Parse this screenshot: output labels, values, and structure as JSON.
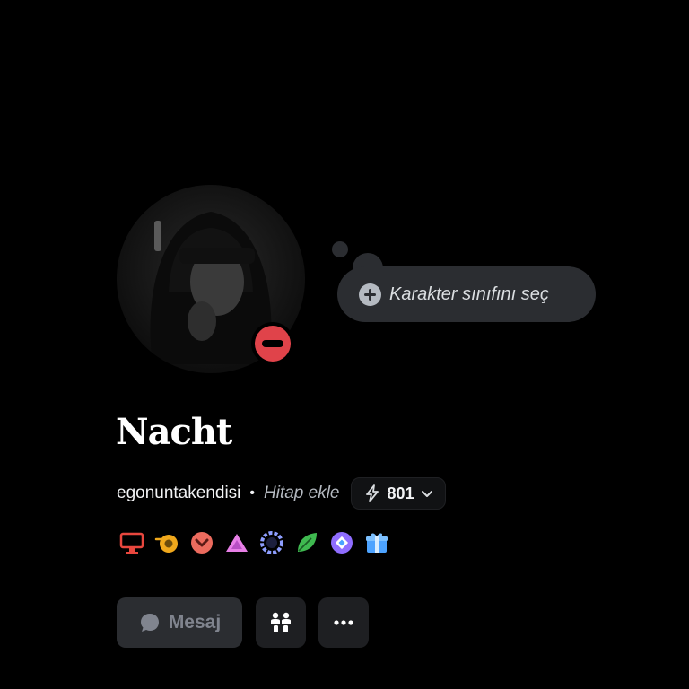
{
  "profile": {
    "display_name": "Nacht",
    "username": "egonuntakendisi",
    "separator": "•",
    "pronoun_placeholder": "Hitap ekle",
    "boost_count": "801",
    "status": "do-not-disturb"
  },
  "bubble": {
    "label": "Karakter sınıfını seç",
    "icon": "plus-circle-icon"
  },
  "badges": [
    {
      "name": "monitor-icon",
      "color": "#e8473e"
    },
    {
      "name": "orbs-icon",
      "color": "#f0a81c"
    },
    {
      "name": "heart-chevron-icon",
      "color": "#ec6b5e"
    },
    {
      "name": "triangle-icon",
      "color": "#e77fe6"
    },
    {
      "name": "wreath-icon",
      "color": "#8e9eff"
    },
    {
      "name": "leaf-icon",
      "color": "#3fb950"
    },
    {
      "name": "gem-icon",
      "color": "#8f6dff"
    },
    {
      "name": "gift-icon",
      "color": "#4da3ff"
    }
  ],
  "actions": {
    "message_label": "Mesaj",
    "message_icon": "chat-bubble-icon",
    "friend_icon": "add-friend-icon",
    "more_icon": "more-dots-icon"
  },
  "colors": {
    "background": "#000000",
    "surface": "#2b2d31",
    "dnd_red": "#e0434a"
  }
}
